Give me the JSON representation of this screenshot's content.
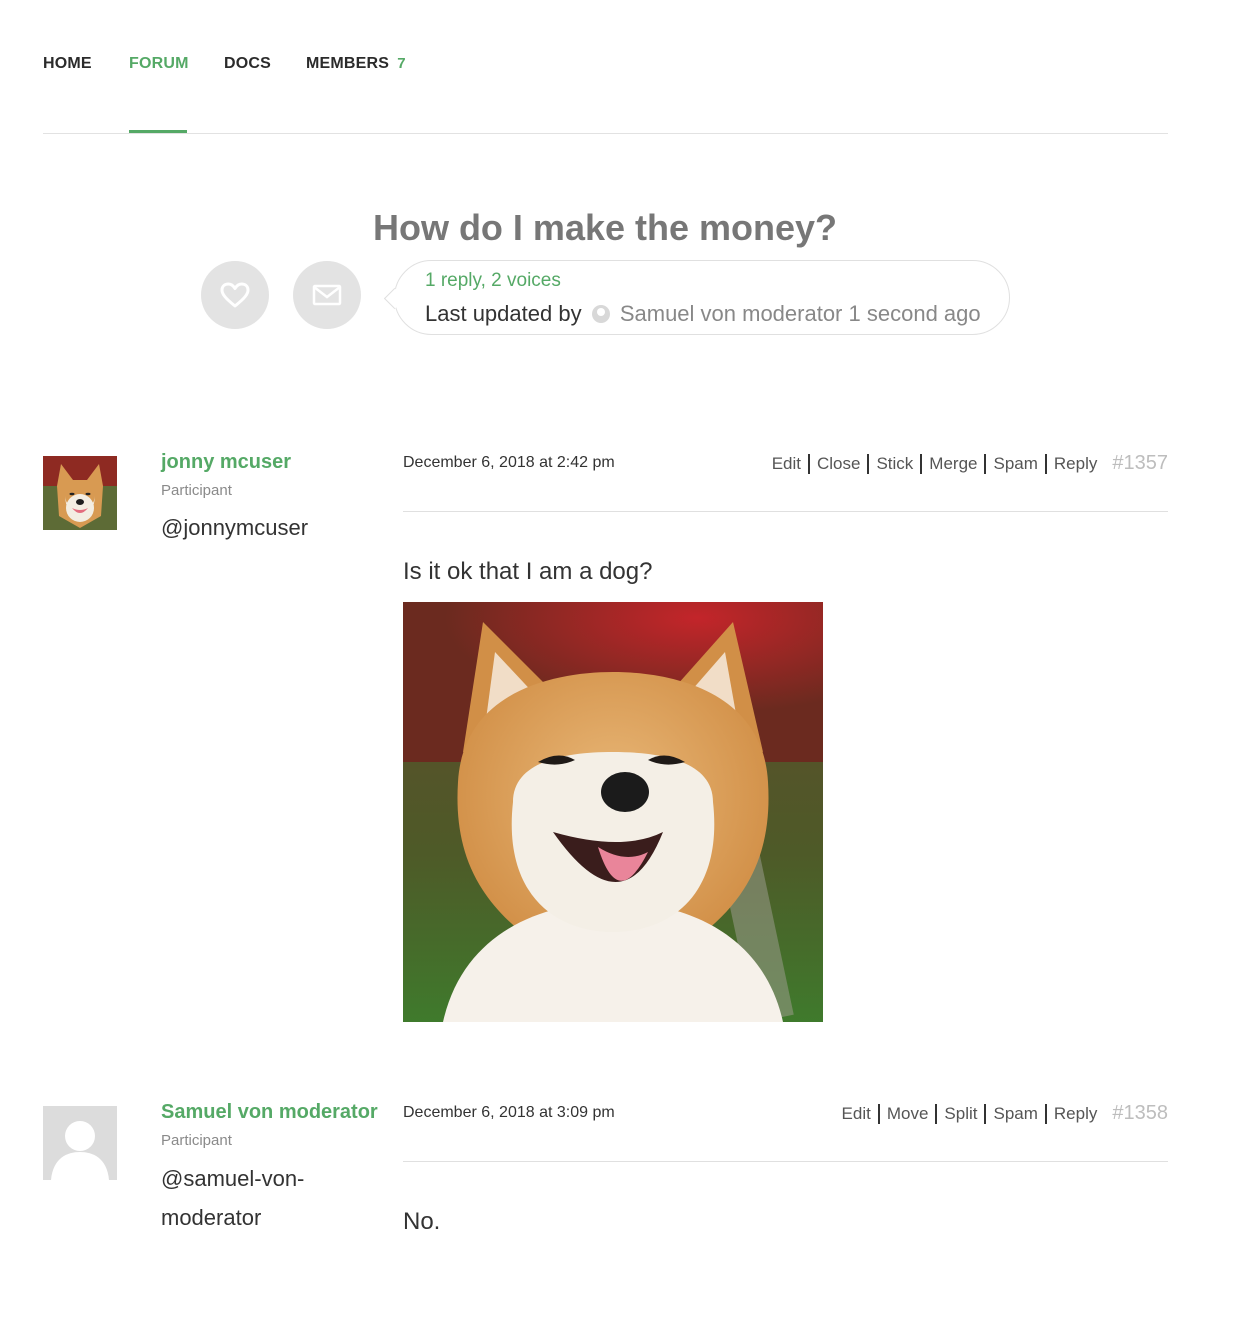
{
  "nav": {
    "items": [
      {
        "label": "HOME",
        "active": false
      },
      {
        "label": "FORUM",
        "active": true
      },
      {
        "label": "DOCS",
        "active": false
      },
      {
        "label": "MEMBERS",
        "active": false,
        "count": "7"
      }
    ]
  },
  "topic": {
    "title": "How do I make the money?",
    "stats": "1 reply, 2 voices",
    "last_updated_prefix": "Last updated by",
    "last_updated_user": "Samuel von moderator",
    "last_updated_time": "1 second ago",
    "favorite_icon": "heart-icon",
    "subscribe_icon": "envelope-icon"
  },
  "posts": [
    {
      "author": "jonny mcuser",
      "role": "Participant",
      "handle": "@jonnymcuser",
      "date": "December 6, 2018 at 2:42 pm",
      "actions": [
        "Edit",
        "Close",
        "Stick",
        "Merge",
        "Spam",
        "Reply"
      ],
      "post_id": "#1357",
      "content": "Is it ok that I am a dog?",
      "avatar": "shiba-inu-dog-photo"
    },
    {
      "author": "Samuel von moderator",
      "role": "Participant",
      "handle": "@samuel-von-moderator",
      "date": "December 6, 2018 at 3:09 pm",
      "actions": [
        "Edit",
        "Move",
        "Split",
        "Spam",
        "Reply"
      ],
      "post_id": "#1358",
      "content": "No.",
      "avatar": "default-user-silhouette"
    }
  ],
  "colors": {
    "accent": "#55a966",
    "title": "#777777",
    "muted": "#8a8a8a",
    "circle_bg": "#e3e3e3"
  }
}
